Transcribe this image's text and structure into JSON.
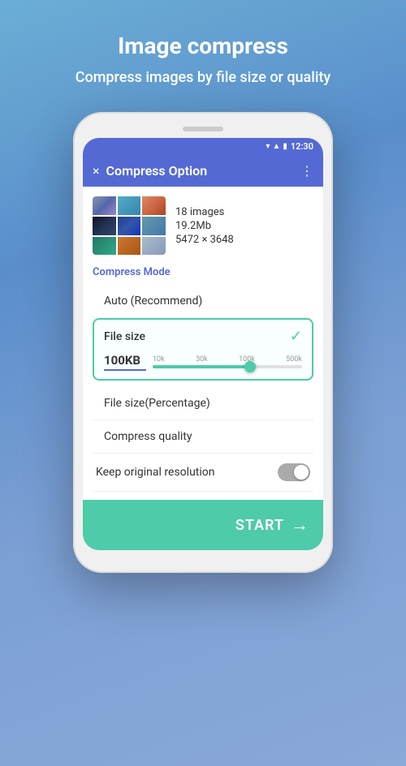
{
  "header": {
    "title": "Image compress",
    "subtitle": "Compress images by file size or quality"
  },
  "status_bar": {
    "time": "12:30",
    "icons": [
      "wifi",
      "signal",
      "battery"
    ]
  },
  "app_bar": {
    "close_icon": "×",
    "title": "Compress Option",
    "menu_icon": "⋮"
  },
  "image_info": {
    "count": "18 images",
    "size": "19.2Mb",
    "dimensions": "5472 × 3648"
  },
  "compress_mode": {
    "label": "Compress Mode",
    "auto_label": "Auto (Recommend)"
  },
  "file_size_option": {
    "title": "File size",
    "value": "100KB",
    "slider_labels": [
      "10k",
      "30k",
      "100k",
      "500k"
    ],
    "fill_percent": 65
  },
  "file_size_percentage": {
    "label": "File size(Percentage)"
  },
  "compress_quality": {
    "label": "Compress quality"
  },
  "keep_resolution": {
    "label": "Keep original resolution",
    "toggle_on": false
  },
  "start_button": {
    "label": "START",
    "arrow": "→"
  }
}
